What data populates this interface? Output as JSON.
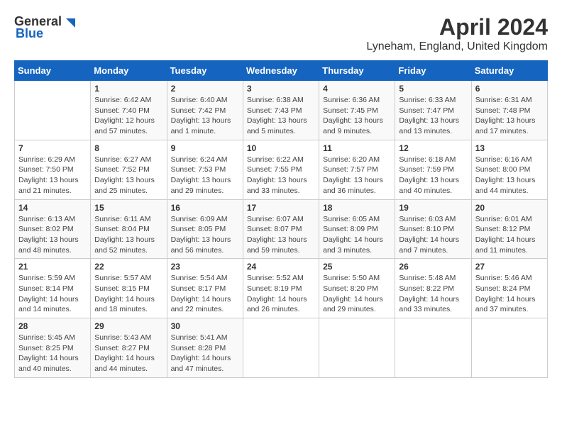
{
  "logo": {
    "general": "General",
    "blue": "Blue"
  },
  "title": {
    "month_year": "April 2024",
    "location": "Lyneham, England, United Kingdom"
  },
  "headers": [
    "Sunday",
    "Monday",
    "Tuesday",
    "Wednesday",
    "Thursday",
    "Friday",
    "Saturday"
  ],
  "weeks": [
    [
      {
        "day": "",
        "info": ""
      },
      {
        "day": "1",
        "info": "Sunrise: 6:42 AM\nSunset: 7:40 PM\nDaylight: 12 hours\nand 57 minutes."
      },
      {
        "day": "2",
        "info": "Sunrise: 6:40 AM\nSunset: 7:42 PM\nDaylight: 13 hours\nand 1 minute."
      },
      {
        "day": "3",
        "info": "Sunrise: 6:38 AM\nSunset: 7:43 PM\nDaylight: 13 hours\nand 5 minutes."
      },
      {
        "day": "4",
        "info": "Sunrise: 6:36 AM\nSunset: 7:45 PM\nDaylight: 13 hours\nand 9 minutes."
      },
      {
        "day": "5",
        "info": "Sunrise: 6:33 AM\nSunset: 7:47 PM\nDaylight: 13 hours\nand 13 minutes."
      },
      {
        "day": "6",
        "info": "Sunrise: 6:31 AM\nSunset: 7:48 PM\nDaylight: 13 hours\nand 17 minutes."
      }
    ],
    [
      {
        "day": "7",
        "info": "Sunrise: 6:29 AM\nSunset: 7:50 PM\nDaylight: 13 hours\nand 21 minutes."
      },
      {
        "day": "8",
        "info": "Sunrise: 6:27 AM\nSunset: 7:52 PM\nDaylight: 13 hours\nand 25 minutes."
      },
      {
        "day": "9",
        "info": "Sunrise: 6:24 AM\nSunset: 7:53 PM\nDaylight: 13 hours\nand 29 minutes."
      },
      {
        "day": "10",
        "info": "Sunrise: 6:22 AM\nSunset: 7:55 PM\nDaylight: 13 hours\nand 33 minutes."
      },
      {
        "day": "11",
        "info": "Sunrise: 6:20 AM\nSunset: 7:57 PM\nDaylight: 13 hours\nand 36 minutes."
      },
      {
        "day": "12",
        "info": "Sunrise: 6:18 AM\nSunset: 7:59 PM\nDaylight: 13 hours\nand 40 minutes."
      },
      {
        "day": "13",
        "info": "Sunrise: 6:16 AM\nSunset: 8:00 PM\nDaylight: 13 hours\nand 44 minutes."
      }
    ],
    [
      {
        "day": "14",
        "info": "Sunrise: 6:13 AM\nSunset: 8:02 PM\nDaylight: 13 hours\nand 48 minutes."
      },
      {
        "day": "15",
        "info": "Sunrise: 6:11 AM\nSunset: 8:04 PM\nDaylight: 13 hours\nand 52 minutes."
      },
      {
        "day": "16",
        "info": "Sunrise: 6:09 AM\nSunset: 8:05 PM\nDaylight: 13 hours\nand 56 minutes."
      },
      {
        "day": "17",
        "info": "Sunrise: 6:07 AM\nSunset: 8:07 PM\nDaylight: 13 hours\nand 59 minutes."
      },
      {
        "day": "18",
        "info": "Sunrise: 6:05 AM\nSunset: 8:09 PM\nDaylight: 14 hours\nand 3 minutes."
      },
      {
        "day": "19",
        "info": "Sunrise: 6:03 AM\nSunset: 8:10 PM\nDaylight: 14 hours\nand 7 minutes."
      },
      {
        "day": "20",
        "info": "Sunrise: 6:01 AM\nSunset: 8:12 PM\nDaylight: 14 hours\nand 11 minutes."
      }
    ],
    [
      {
        "day": "21",
        "info": "Sunrise: 5:59 AM\nSunset: 8:14 PM\nDaylight: 14 hours\nand 14 minutes."
      },
      {
        "day": "22",
        "info": "Sunrise: 5:57 AM\nSunset: 8:15 PM\nDaylight: 14 hours\nand 18 minutes."
      },
      {
        "day": "23",
        "info": "Sunrise: 5:54 AM\nSunset: 8:17 PM\nDaylight: 14 hours\nand 22 minutes."
      },
      {
        "day": "24",
        "info": "Sunrise: 5:52 AM\nSunset: 8:19 PM\nDaylight: 14 hours\nand 26 minutes."
      },
      {
        "day": "25",
        "info": "Sunrise: 5:50 AM\nSunset: 8:20 PM\nDaylight: 14 hours\nand 29 minutes."
      },
      {
        "day": "26",
        "info": "Sunrise: 5:48 AM\nSunset: 8:22 PM\nDaylight: 14 hours\nand 33 minutes."
      },
      {
        "day": "27",
        "info": "Sunrise: 5:46 AM\nSunset: 8:24 PM\nDaylight: 14 hours\nand 37 minutes."
      }
    ],
    [
      {
        "day": "28",
        "info": "Sunrise: 5:45 AM\nSunset: 8:25 PM\nDaylight: 14 hours\nand 40 minutes."
      },
      {
        "day": "29",
        "info": "Sunrise: 5:43 AM\nSunset: 8:27 PM\nDaylight: 14 hours\nand 44 minutes."
      },
      {
        "day": "30",
        "info": "Sunrise: 5:41 AM\nSunset: 8:28 PM\nDaylight: 14 hours\nand 47 minutes."
      },
      {
        "day": "",
        "info": ""
      },
      {
        "day": "",
        "info": ""
      },
      {
        "day": "",
        "info": ""
      },
      {
        "day": "",
        "info": ""
      }
    ]
  ]
}
